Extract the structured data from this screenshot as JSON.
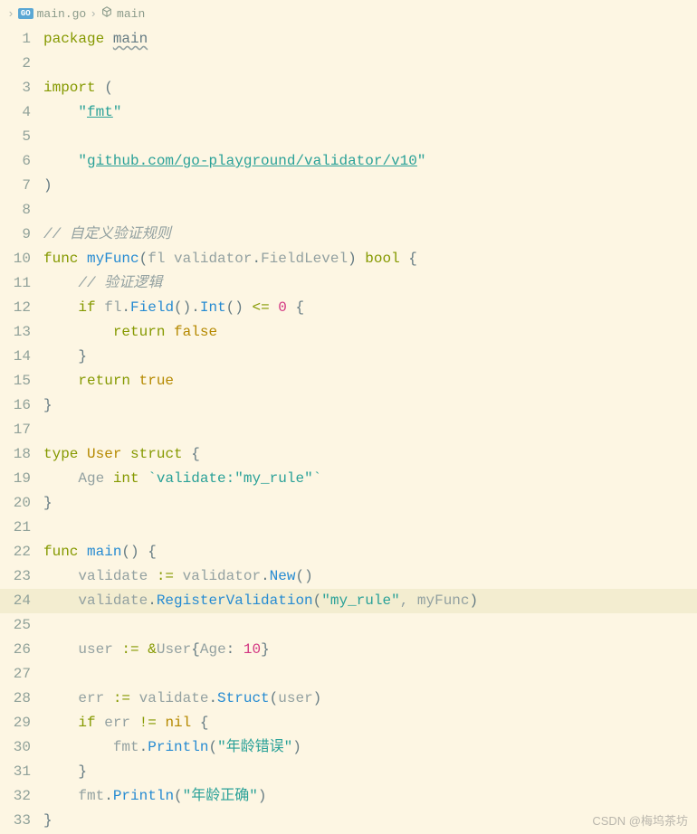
{
  "breadcrumb": {
    "file": "main.go",
    "symbol": "main"
  },
  "code": {
    "lines": [
      {
        "n": 1,
        "segs": [
          {
            "t": "package ",
            "c": "k"
          },
          {
            "t": "main",
            "c": "wavy pkg"
          }
        ]
      },
      {
        "n": 2,
        "segs": []
      },
      {
        "n": 3,
        "segs": [
          {
            "t": "import ",
            "c": "k"
          },
          {
            "t": "(",
            "c": "p"
          }
        ]
      },
      {
        "n": 4,
        "segs": [
          {
            "t": "    ",
            "c": "t"
          },
          {
            "t": "\"",
            "c": "s"
          },
          {
            "t": "fmt",
            "c": "s ul"
          },
          {
            "t": "\"",
            "c": "s"
          }
        ]
      },
      {
        "n": 5,
        "segs": []
      },
      {
        "n": 6,
        "segs": [
          {
            "t": "    ",
            "c": "t"
          },
          {
            "t": "\"",
            "c": "s"
          },
          {
            "t": "github.com/go-playground/validator/v10",
            "c": "s ul"
          },
          {
            "t": "\"",
            "c": "s"
          }
        ]
      },
      {
        "n": 7,
        "segs": [
          {
            "t": ")",
            "c": "p"
          }
        ]
      },
      {
        "n": 8,
        "segs": []
      },
      {
        "n": 9,
        "segs": [
          {
            "t": "// 自定义验证规则",
            "c": "c"
          }
        ]
      },
      {
        "n": 10,
        "segs": [
          {
            "t": "func ",
            "c": "k"
          },
          {
            "t": "myFunc",
            "c": "fn"
          },
          {
            "t": "(",
            "c": "p"
          },
          {
            "t": "fl",
            "c": "il"
          },
          {
            "t": " validator",
            "c": "t"
          },
          {
            "t": ".",
            "c": "p"
          },
          {
            "t": "FieldLevel",
            "c": "t"
          },
          {
            "t": ") ",
            "c": "p"
          },
          {
            "t": "bool",
            "c": "k"
          },
          {
            "t": " {",
            "c": "p"
          }
        ]
      },
      {
        "n": 11,
        "segs": [
          {
            "t": "    ",
            "c": "t"
          },
          {
            "t": "// 验证逻辑",
            "c": "c"
          }
        ]
      },
      {
        "n": 12,
        "segs": [
          {
            "t": "    ",
            "c": "t"
          },
          {
            "t": "if ",
            "c": "k"
          },
          {
            "t": "fl",
            "c": "t"
          },
          {
            "t": ".",
            "c": "p"
          },
          {
            "t": "Field",
            "c": "fn"
          },
          {
            "t": "().",
            "c": "p"
          },
          {
            "t": "Int",
            "c": "fn"
          },
          {
            "t": "() ",
            "c": "p"
          },
          {
            "t": "<= ",
            "c": "k"
          },
          {
            "t": "0",
            "c": "n"
          },
          {
            "t": " {",
            "c": "p"
          }
        ]
      },
      {
        "n": 13,
        "segs": [
          {
            "t": "        ",
            "c": "t"
          },
          {
            "t": "return ",
            "c": "k"
          },
          {
            "t": "false",
            "c": "ty"
          }
        ]
      },
      {
        "n": 14,
        "segs": [
          {
            "t": "    }",
            "c": "p"
          }
        ]
      },
      {
        "n": 15,
        "segs": [
          {
            "t": "    ",
            "c": "t"
          },
          {
            "t": "return ",
            "c": "k"
          },
          {
            "t": "true",
            "c": "ty"
          }
        ]
      },
      {
        "n": 16,
        "segs": [
          {
            "t": "}",
            "c": "p"
          }
        ]
      },
      {
        "n": 17,
        "segs": []
      },
      {
        "n": 18,
        "segs": [
          {
            "t": "type ",
            "c": "k"
          },
          {
            "t": "User",
            "c": "ty"
          },
          {
            "t": " ",
            "c": "t"
          },
          {
            "t": "struct",
            "c": "k"
          },
          {
            "t": " {",
            "c": "p"
          }
        ]
      },
      {
        "n": 19,
        "segs": [
          {
            "t": "    Age ",
            "c": "t"
          },
          {
            "t": "int",
            "c": "k"
          },
          {
            "t": " ",
            "c": "t"
          },
          {
            "t": "`validate:\"my_rule\"`",
            "c": "s"
          }
        ]
      },
      {
        "n": 20,
        "segs": [
          {
            "t": "}",
            "c": "p"
          }
        ]
      },
      {
        "n": 21,
        "segs": []
      },
      {
        "n": 22,
        "segs": [
          {
            "t": "func ",
            "c": "k"
          },
          {
            "t": "main",
            "c": "fn"
          },
          {
            "t": "() {",
            "c": "p"
          }
        ]
      },
      {
        "n": 23,
        "segs": [
          {
            "t": "    validate ",
            "c": "t"
          },
          {
            "t": ":= ",
            "c": "k"
          },
          {
            "t": "validator",
            "c": "t"
          },
          {
            "t": ".",
            "c": "p"
          },
          {
            "t": "New",
            "c": "fn"
          },
          {
            "t": "()",
            "c": "p"
          }
        ]
      },
      {
        "n": 24,
        "hl": true,
        "segs": [
          {
            "t": "    validate",
            "c": "t"
          },
          {
            "t": ".",
            "c": "p"
          },
          {
            "t": "RegisterValidation",
            "c": "fn"
          },
          {
            "t": "(",
            "c": "p"
          },
          {
            "t": "\"my_rule\"",
            "c": "s"
          },
          {
            "t": ", myFunc",
            "c": "t"
          },
          {
            "t": ")",
            "c": "p"
          }
        ]
      },
      {
        "n": 25,
        "segs": []
      },
      {
        "n": 26,
        "segs": [
          {
            "t": "    user ",
            "c": "t"
          },
          {
            "t": ":= ",
            "c": "k"
          },
          {
            "t": "&",
            "c": "k"
          },
          {
            "t": "User",
            "c": "t"
          },
          {
            "t": "{",
            "c": "p"
          },
          {
            "t": "Age",
            "c": "t"
          },
          {
            "t": ": ",
            "c": "p"
          },
          {
            "t": "10",
            "c": "n"
          },
          {
            "t": "}",
            "c": "p"
          }
        ]
      },
      {
        "n": 27,
        "segs": []
      },
      {
        "n": 28,
        "segs": [
          {
            "t": "    err ",
            "c": "t"
          },
          {
            "t": ":= ",
            "c": "k"
          },
          {
            "t": "validate",
            "c": "t"
          },
          {
            "t": ".",
            "c": "p"
          },
          {
            "t": "Struct",
            "c": "fn"
          },
          {
            "t": "(",
            "c": "p"
          },
          {
            "t": "user",
            "c": "t"
          },
          {
            "t": ")",
            "c": "p"
          }
        ]
      },
      {
        "n": 29,
        "segs": [
          {
            "t": "    ",
            "c": "t"
          },
          {
            "t": "if ",
            "c": "k"
          },
          {
            "t": "err ",
            "c": "t"
          },
          {
            "t": "!= ",
            "c": "k"
          },
          {
            "t": "nil",
            "c": "ty"
          },
          {
            "t": " {",
            "c": "p"
          }
        ]
      },
      {
        "n": 30,
        "segs": [
          {
            "t": "        fmt",
            "c": "t"
          },
          {
            "t": ".",
            "c": "p"
          },
          {
            "t": "Println",
            "c": "fn"
          },
          {
            "t": "(",
            "c": "p"
          },
          {
            "t": "\"年龄错误\"",
            "c": "s"
          },
          {
            "t": ")",
            "c": "p"
          }
        ]
      },
      {
        "n": 31,
        "segs": [
          {
            "t": "    }",
            "c": "p"
          }
        ]
      },
      {
        "n": 32,
        "segs": [
          {
            "t": "    fmt",
            "c": "t"
          },
          {
            "t": ".",
            "c": "p"
          },
          {
            "t": "Println",
            "c": "fn"
          },
          {
            "t": "(",
            "c": "p"
          },
          {
            "t": "\"年龄正确\"",
            "c": "s"
          },
          {
            "t": ")",
            "c": "p"
          }
        ]
      },
      {
        "n": 33,
        "segs": [
          {
            "t": "}",
            "c": "p"
          }
        ]
      }
    ]
  },
  "watermark": "CSDN @梅坞茶坊"
}
